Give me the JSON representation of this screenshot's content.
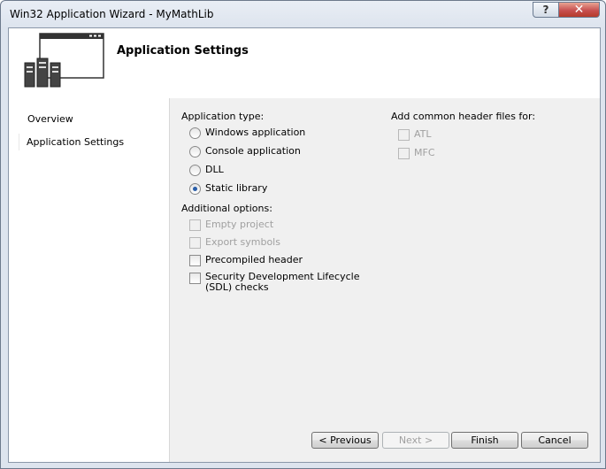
{
  "window": {
    "title": "Win32 Application Wizard - MyMathLib",
    "help_label": "?",
    "close_label": "✕"
  },
  "header": {
    "title": "Application Settings",
    "illustration_icon": "application-window-icon"
  },
  "nav": {
    "items": [
      {
        "label": "Overview"
      },
      {
        "label": "Application Settings"
      }
    ]
  },
  "app_type": {
    "label": "Application type:",
    "options": [
      {
        "label": "Windows application",
        "checked": false
      },
      {
        "label": "Console application",
        "checked": false
      },
      {
        "label": "DLL",
        "checked": false
      },
      {
        "label": "Static library",
        "checked": true
      }
    ]
  },
  "additional": {
    "label": "Additional options:",
    "options": [
      {
        "label": "Empty project",
        "enabled": false
      },
      {
        "label": "Export symbols",
        "enabled": false
      },
      {
        "label": "Precompiled header",
        "enabled": true
      },
      {
        "label": "Security Development Lifecycle (SDL) checks",
        "enabled": true
      }
    ]
  },
  "common_headers": {
    "label": "Add common header files for:",
    "options": [
      {
        "label": "ATL",
        "enabled": false
      },
      {
        "label": "MFC",
        "enabled": false
      }
    ]
  },
  "buttons": {
    "previous": "< Previous",
    "next": "Next >",
    "finish": "Finish",
    "cancel": "Cancel"
  }
}
